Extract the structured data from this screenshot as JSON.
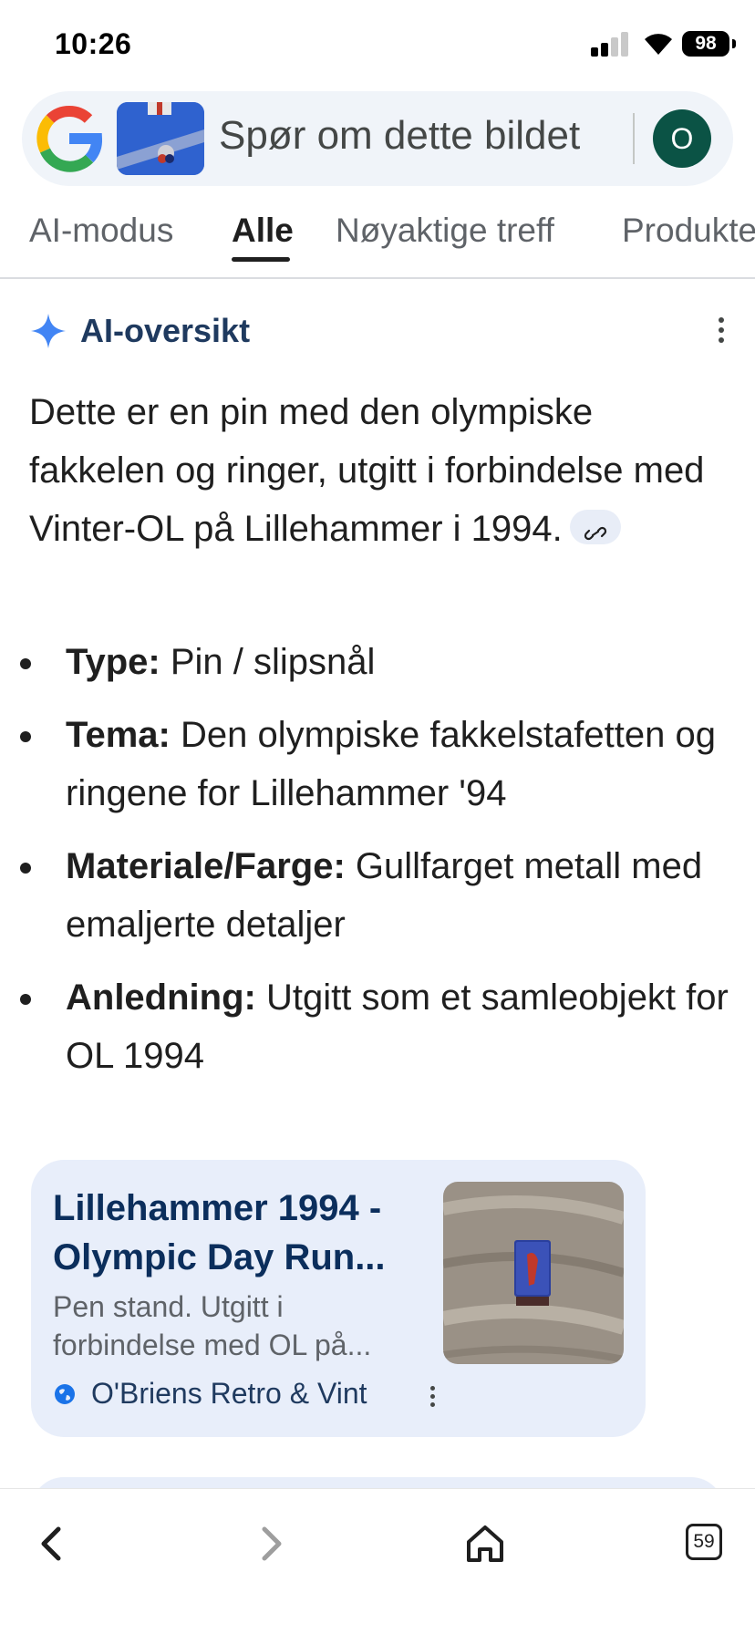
{
  "status_bar": {
    "time": "10:26",
    "battery": "98"
  },
  "search": {
    "placeholder": "Spør om dette bildet",
    "avatar_initial": "O"
  },
  "tabs": [
    {
      "label": "AI-modus",
      "active": false
    },
    {
      "label": "Alle",
      "active": true
    },
    {
      "label": "Nøyaktige treff",
      "active": false
    },
    {
      "label": "Produkter",
      "active": false
    }
  ],
  "ai_overview": {
    "title": "AI-oversikt",
    "summary": "Dette er en pin med den olympiske fakkelen og ringer, utgitt i forbindelse med Vinter-OL på Lillehammer i 1994.",
    "bullets": [
      {
        "label": "Type:",
        "text": "Pin / slipsnål"
      },
      {
        "label": "Tema:",
        "text": "Den olympiske fakkelstafetten og ringene for Lillehammer '94"
      },
      {
        "label": "Materiale/Farge:",
        "text": "Gullfarget metall med emaljerte detaljer"
      },
      {
        "label": "Anledning:",
        "text": "Utgitt som et samleobjekt for OL 1994"
      }
    ]
  },
  "source_card": {
    "title": "Lillehammer 1994 - Olympic Day Run...",
    "snippet": "Pen stand. Utgitt i forbindelse med OL på...",
    "source": "O'Briens Retro & Vint"
  },
  "bottom_nav": {
    "tab_count": "59"
  },
  "colors": {
    "accent_blue": "#4285f4",
    "avatar_bg": "#0b5345",
    "card_bg": "#e8eefa",
    "search_bg": "#f0f4f9"
  }
}
